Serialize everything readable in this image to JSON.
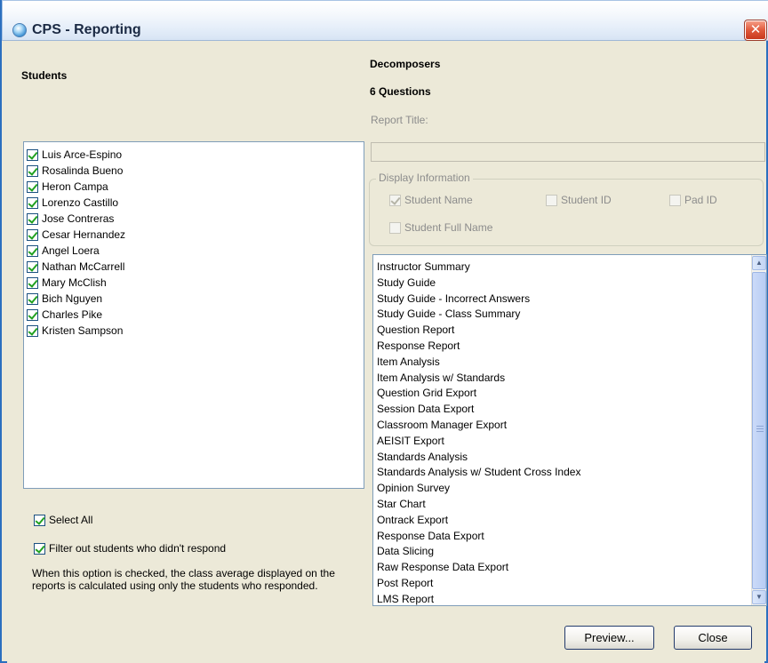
{
  "window": {
    "title": "CPS - Reporting",
    "close_glyph": "✕"
  },
  "students": {
    "heading": "Students",
    "list": [
      {
        "name": "Luis Arce-Espino",
        "checked": true
      },
      {
        "name": "Rosalinda Bueno",
        "checked": true
      },
      {
        "name": "Heron Campa",
        "checked": true
      },
      {
        "name": "Lorenzo Castillo",
        "checked": true
      },
      {
        "name": "Jose Contreras",
        "checked": true
      },
      {
        "name": "Cesar Hernandez",
        "checked": true
      },
      {
        "name": "Angel Loera",
        "checked": true
      },
      {
        "name": "Nathan McCarrell",
        "checked": true
      },
      {
        "name": "Mary McClish",
        "checked": true
      },
      {
        "name": "Bich Nguyen",
        "checked": true
      },
      {
        "name": "Charles Pike",
        "checked": true
      },
      {
        "name": "Kristen Sampson",
        "checked": true
      }
    ],
    "select_all_label": "Select All",
    "select_all_checked": true,
    "filter_label": "Filter out students who didn't respond",
    "filter_checked": true,
    "filter_note": "When this option is checked, the class average displayed on the reports is calculated using only the students who responded."
  },
  "session": {
    "name": "Decomposers",
    "questions": "6 Questions",
    "report_title_label": "Report Title:",
    "report_title_value": ""
  },
  "display_info": {
    "legend": "Display Information",
    "options": {
      "student_name": {
        "label": "Student Name",
        "checked": true,
        "enabled": false
      },
      "student_id": {
        "label": "Student ID",
        "checked": false,
        "enabled": false
      },
      "pad_id": {
        "label": "Pad ID",
        "checked": false,
        "enabled": false
      },
      "student_full_name": {
        "label": "Student Full Name",
        "checked": false,
        "enabled": false
      }
    }
  },
  "reports": [
    "Instructor Summary",
    "Study Guide",
    "Study Guide - Incorrect Answers",
    "Study Guide - Class Summary",
    "Question Report",
    "Response Report",
    "Item Analysis",
    "Item Analysis w/ Standards",
    "Question Grid Export",
    "Session Data Export",
    "Classroom Manager Export",
    "AEISIT Export",
    "Standards Analysis",
    "Standards Analysis w/ Student Cross Index",
    "Opinion Survey",
    "Star Chart",
    "Ontrack Export",
    "Response Data Export",
    "Data Slicing",
    "Raw Response Data Export",
    "Post Report",
    "LMS Report"
  ],
  "buttons": {
    "preview": "Preview...",
    "close": "Close"
  },
  "colors": {
    "titlebar_border": "#2b6fbf",
    "dialog_bg": "#ece9d8",
    "check": "#21a121",
    "close_red": "#e0593b"
  }
}
